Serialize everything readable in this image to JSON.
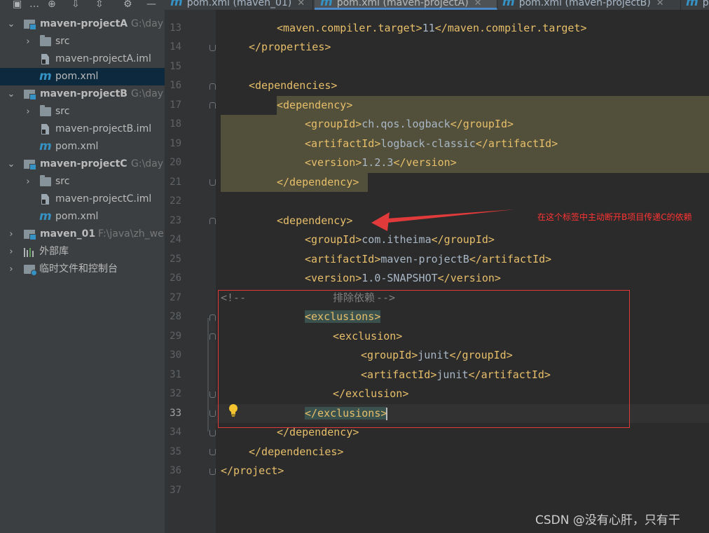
{
  "sidebar": {
    "items": [
      {
        "label": "maven-projectA",
        "path": "G:\\day"
      },
      {
        "label": "src"
      },
      {
        "label": "maven-projectA.iml"
      },
      {
        "label": "pom.xml"
      },
      {
        "label": "maven-projectB",
        "path": "G:\\day"
      },
      {
        "label": "src"
      },
      {
        "label": "maven-projectB.iml"
      },
      {
        "label": "pom.xml"
      },
      {
        "label": "maven-projectC",
        "path": "G:\\day"
      },
      {
        "label": "src"
      },
      {
        "label": "maven-projectC.iml"
      },
      {
        "label": "pom.xml"
      },
      {
        "label": "maven_01",
        "path": "F:\\java\\zh_we"
      },
      {
        "label": "外部库"
      },
      {
        "label": "临时文件和控制台"
      }
    ]
  },
  "tabs": [
    {
      "label": "pom.xml (maven_01)"
    },
    {
      "label": "pom.xml (maven-projectA)"
    },
    {
      "label": "pom.xml (maven-projectB)"
    },
    {
      "label": "po"
    }
  ],
  "editor": {
    "line_numbers": [
      "13",
      "14",
      "15",
      "16",
      "17",
      "18",
      "19",
      "20",
      "21",
      "22",
      "23",
      "24",
      "25",
      "26",
      "27",
      "28",
      "29",
      "30",
      "31",
      "32",
      "33",
      "34",
      "35",
      "36",
      "37"
    ],
    "current_line": "33",
    "code": {
      "l13": {
        "open": "<maven.compiler.target>",
        "text": "11",
        "close": "</maven.compiler.target>"
      },
      "l14": {
        "close": "</properties>"
      },
      "l16": {
        "open": "<dependencies>"
      },
      "l17": {
        "open": "<dependency>"
      },
      "l18": {
        "open": "<groupId>",
        "text": "ch.qos.logback",
        "close": "</groupId>"
      },
      "l19": {
        "open": "<artifactId>",
        "text": "logback-classic",
        "close": "</artifactId>"
      },
      "l20": {
        "open": "<version>",
        "text": "1.2.3",
        "close": "</version>"
      },
      "l21": {
        "close": "</dependency>"
      },
      "l23": {
        "open": "<dependency>"
      },
      "l24": {
        "open": "<groupId>",
        "text": "com.itheima",
        "close": "</groupId>"
      },
      "l25": {
        "open": "<artifactId>",
        "text": "maven-projectB",
        "close": "</artifactId>"
      },
      "l26": {
        "open": "<version>",
        "text": "1.0-SNAPSHOT",
        "close": "</version>"
      },
      "l27": {
        "comment_start": "<!--",
        "comment_text": "排除依赖",
        "comment_end": "-->"
      },
      "l28": {
        "open": "<exclusions>"
      },
      "l29": {
        "open": "<exclusion>"
      },
      "l30": {
        "open": "<groupId>",
        "text": "junit",
        "close": "</groupId>"
      },
      "l31": {
        "open": "<artifactId>",
        "text": "junit",
        "close": "</artifactId>"
      },
      "l32": {
        "close": "</exclusion>"
      },
      "l33": {
        "close": "</exclusions>"
      },
      "l34": {
        "close": "</dependency>"
      },
      "l35": {
        "close": "</dependencies>"
      },
      "l36": {
        "close": "</project>"
      }
    }
  },
  "annotation": {
    "text": "在这个标签中主动断开B项目传递C的依赖",
    "color": "#ff3333"
  },
  "watermark": "CSDN @没有心肝，只有干",
  "colors": {
    "accent": "#3592c4",
    "tag": "#e8bf6a",
    "highlight_box": "#e03a3a"
  }
}
